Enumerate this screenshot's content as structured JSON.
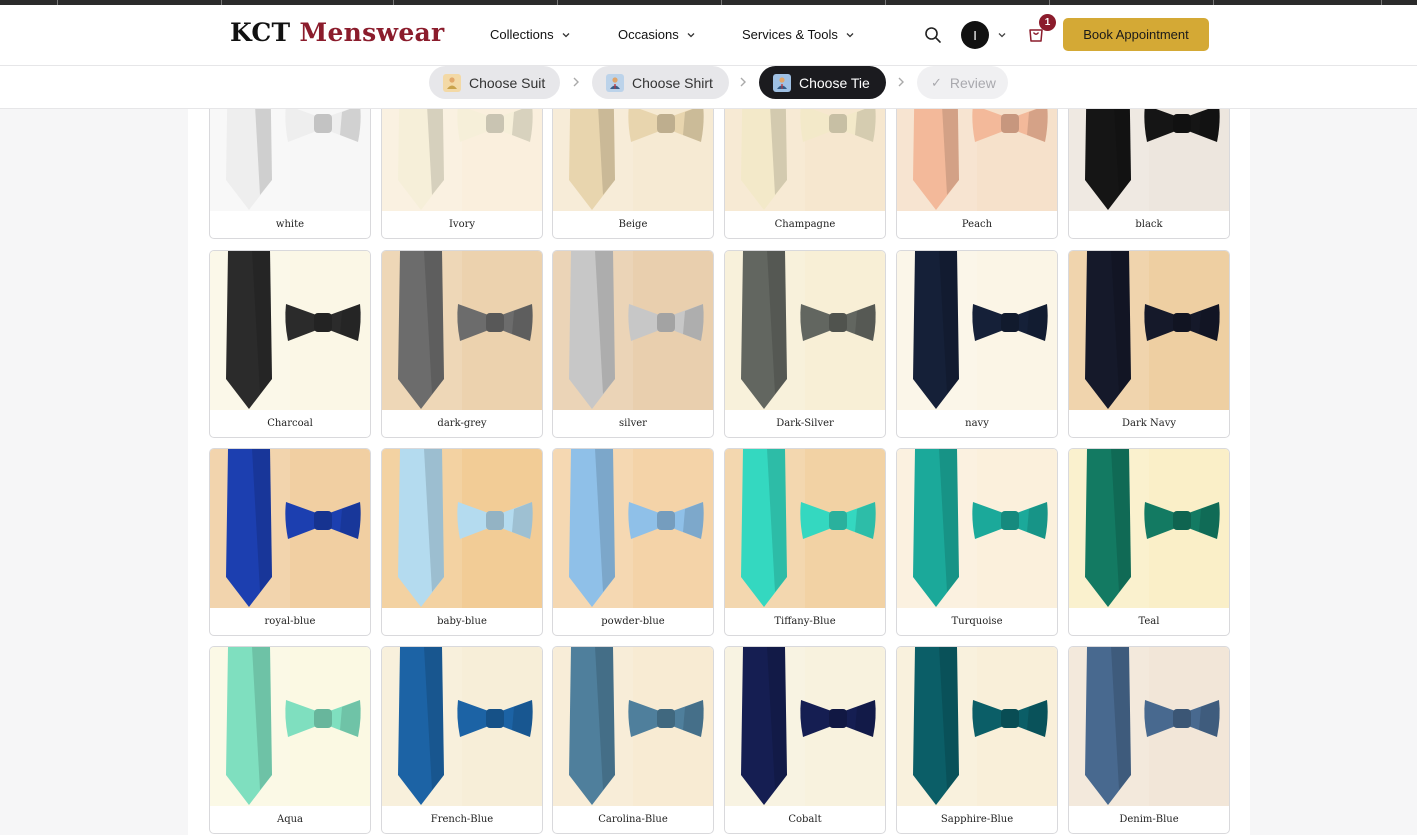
{
  "brand": {
    "part1": "KCT",
    "part2": "Menswear"
  },
  "nav": [
    {
      "label": "Collections",
      "key": "collections"
    },
    {
      "label": "Occasions",
      "key": "occasions"
    },
    {
      "label": "Services & Tools",
      "key": "services"
    }
  ],
  "header": {
    "avatar_initial": "I",
    "cart_count": "1",
    "book_label": "Book Appointment"
  },
  "steps": [
    {
      "key": "suit",
      "icon": "suit-emoji-icon",
      "label": "Choose Suit",
      "state": "done"
    },
    {
      "key": "shirt",
      "icon": "shirt-emoji-icon",
      "label": "Choose Shirt",
      "state": "done"
    },
    {
      "key": "tie",
      "icon": "tie-emoji-icon",
      "label": "Choose Tie",
      "state": "active"
    },
    {
      "key": "review",
      "icon": "checkmark-icon",
      "label": "Review",
      "state": "disabled"
    }
  ],
  "ties": [
    {
      "name": "white",
      "tie": "#eeeeee",
      "bg": "#f7f7f7"
    },
    {
      "name": "Ivory",
      "tie": "#f6efd9",
      "bg": "#faefdd"
    },
    {
      "name": "Beige",
      "tie": "#e8d5ae",
      "bg": "#f6ead3"
    },
    {
      "name": "Champagne",
      "tie": "#f3e9c9",
      "bg": "#f6e7cf"
    },
    {
      "name": "Peach",
      "tie": "#f3b99a",
      "bg": "#f6e1cb"
    },
    {
      "name": "black",
      "tie": "#151515",
      "bg": "#ede6de"
    },
    {
      "name": "Charcoal",
      "tie": "#2b2b2b",
      "bg": "#fbf7e6"
    },
    {
      "name": "dark-grey",
      "tie": "#6c6c6c",
      "bg": "#ecd2ae"
    },
    {
      "name": "silver",
      "tie": "#c7c7c7",
      "bg": "#e9cfae"
    },
    {
      "name": "Dark-Silver",
      "tie": "#626660",
      "bg": "#f8efd6"
    },
    {
      "name": "navy",
      "tie": "#152038",
      "bg": "#fbf5e6"
    },
    {
      "name": "Dark Navy",
      "tie": "#15192a",
      "bg": "#eecfa2"
    },
    {
      "name": "royal-blue",
      "tie": "#1c3fb0",
      "bg": "#f1cfa2"
    },
    {
      "name": "baby-blue",
      "tie": "#b4dbef",
      "bg": "#f2cc96"
    },
    {
      "name": "powder-blue",
      "tie": "#8fc0e8",
      "bg": "#f4d3a8"
    },
    {
      "name": "Tiffany-Blue",
      "tie": "#34d8c0",
      "bg": "#f2d2a4"
    },
    {
      "name": "Turquoise",
      "tie": "#1ba99a",
      "bg": "#fbf0dc"
    },
    {
      "name": "Teal",
      "tie": "#137a62",
      "bg": "#faefc8"
    },
    {
      "name": "Aqua",
      "tie": "#7fdfbf",
      "bg": "#fbf9e3"
    },
    {
      "name": "French-Blue",
      "tie": "#1c63a5",
      "bg": "#f7eed8"
    },
    {
      "name": "Carolina-Blue",
      "tie": "#4f7f9c",
      "bg": "#f8ebd3"
    },
    {
      "name": "Cobalt",
      "tie": "#151e52",
      "bg": "#f8f2de"
    },
    {
      "name": "Sapphire-Blue",
      "tie": "#0b5e67",
      "bg": "#f9efd9"
    },
    {
      "name": "Denim-Blue",
      "tie": "#48698f",
      "bg": "#f2e6d8"
    }
  ]
}
